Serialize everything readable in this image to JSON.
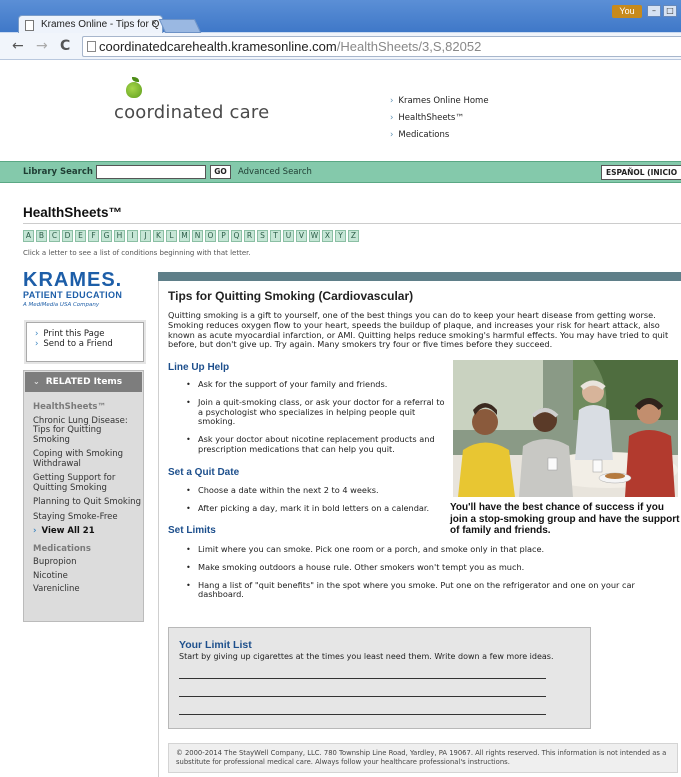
{
  "browser": {
    "tab_title": "Krames Online - Tips for Q",
    "tab_close": "×",
    "user_badge": "You",
    "url_host": "coordinatedcarehealth.kramesonline.com",
    "url_path": "/HealthSheets/3,S,82052",
    "back_icon": "←",
    "forward_icon": "→",
    "reload_icon": "C"
  },
  "header": {
    "brand_name": "coordinated care",
    "links": [
      "Krames Online Home",
      "HealthSheets™",
      "Medications"
    ]
  },
  "search": {
    "label": "Library Search",
    "input_value": "",
    "go_label": "GO",
    "advanced_label": "Advanced Search",
    "language_label": "ESPAÑOL (INICIO"
  },
  "healthsheets": {
    "title": "HealthSheets™",
    "letters": [
      "A",
      "B",
      "C",
      "D",
      "E",
      "F",
      "G",
      "H",
      "I",
      "J",
      "K",
      "L",
      "M",
      "N",
      "O",
      "P",
      "Q",
      "R",
      "S",
      "T",
      "U",
      "V",
      "W",
      "X",
      "Y",
      "Z"
    ],
    "hint": "Click a letter to see a list of conditions beginning with that letter."
  },
  "sidebar": {
    "krames_line1": "KRAMES.",
    "krames_line2": "PATIENT EDUCATION",
    "krames_line3": "A MediMedia USA Company",
    "actions": [
      "Print this Page",
      "Send to a Friend"
    ],
    "related_title": "RELATED Items",
    "healthsheets_cat": "HealthSheets™",
    "healthsheets_items": [
      "Chronic Lung Disease: Tips for Quitting Smoking",
      "Coping with Smoking Withdrawal",
      "Getting Support for Quitting Smoking",
      "Planning to Quit Smoking",
      "Staying Smoke-Free"
    ],
    "view_all": "View All 21",
    "medications_cat": "Medications",
    "medications_items": [
      "Bupropion",
      "Nicotine",
      "Varenicline"
    ]
  },
  "article": {
    "title": "Tips for Quitting Smoking (Cardiovascular)",
    "intro": "Quitting smoking is a gift to yourself, one of the best things you can do to keep your heart disease from getting worse. Smoking reduces oxygen flow to your heart, speeds the buildup of plaque, and increases your risk for heart attack, also known as acute myocardial infarction, or AMI. Quitting helps reduce smoking's harmful effects. You may have tried to quit before, but don't give up. Try again. Many smokers try four or five times before they succeed.",
    "section1_title": "Line Up Help",
    "section1_items": [
      "Ask for the support of your family and friends.",
      "Join a quit-smoking class, or ask your doctor for a referral to a psychologist who specializes in helping people quit smoking.",
      "Ask your doctor about nicotine replacement products and prescription medications that can help you quit."
    ],
    "section2_title": "Set a Quit Date",
    "section2_items": [
      "Choose a date within the next 2 to 4 weeks.",
      "After picking a day, mark it in bold letters on a calendar."
    ],
    "section3_title": "Set Limits",
    "section3_items": [
      "Limit where you can smoke. Pick one room or a porch, and smoke only in that place.",
      "Make smoking outdoors a house rule. Other smokers won't tempt you as much.",
      "Hang a list of  \"quit benefits\" in the spot where you smoke. Put one on the refrigerator and one on your car dashboard."
    ],
    "photo_caption": "You'll have the best chance of success if you join a stop-smoking group and have the support of family and friends.",
    "limit_title": "Your Limit List",
    "limit_text": "Start by giving up cigarettes at the times you least need them. Write down a few more ideas.",
    "footer": "© 2000-2014 The StayWell Company, LLC. 780 Township Line Road, Yardley, PA 19067. All rights reserved. This information is not intended as a substitute for professional medical care. Always follow your healthcare professional's instructions."
  }
}
